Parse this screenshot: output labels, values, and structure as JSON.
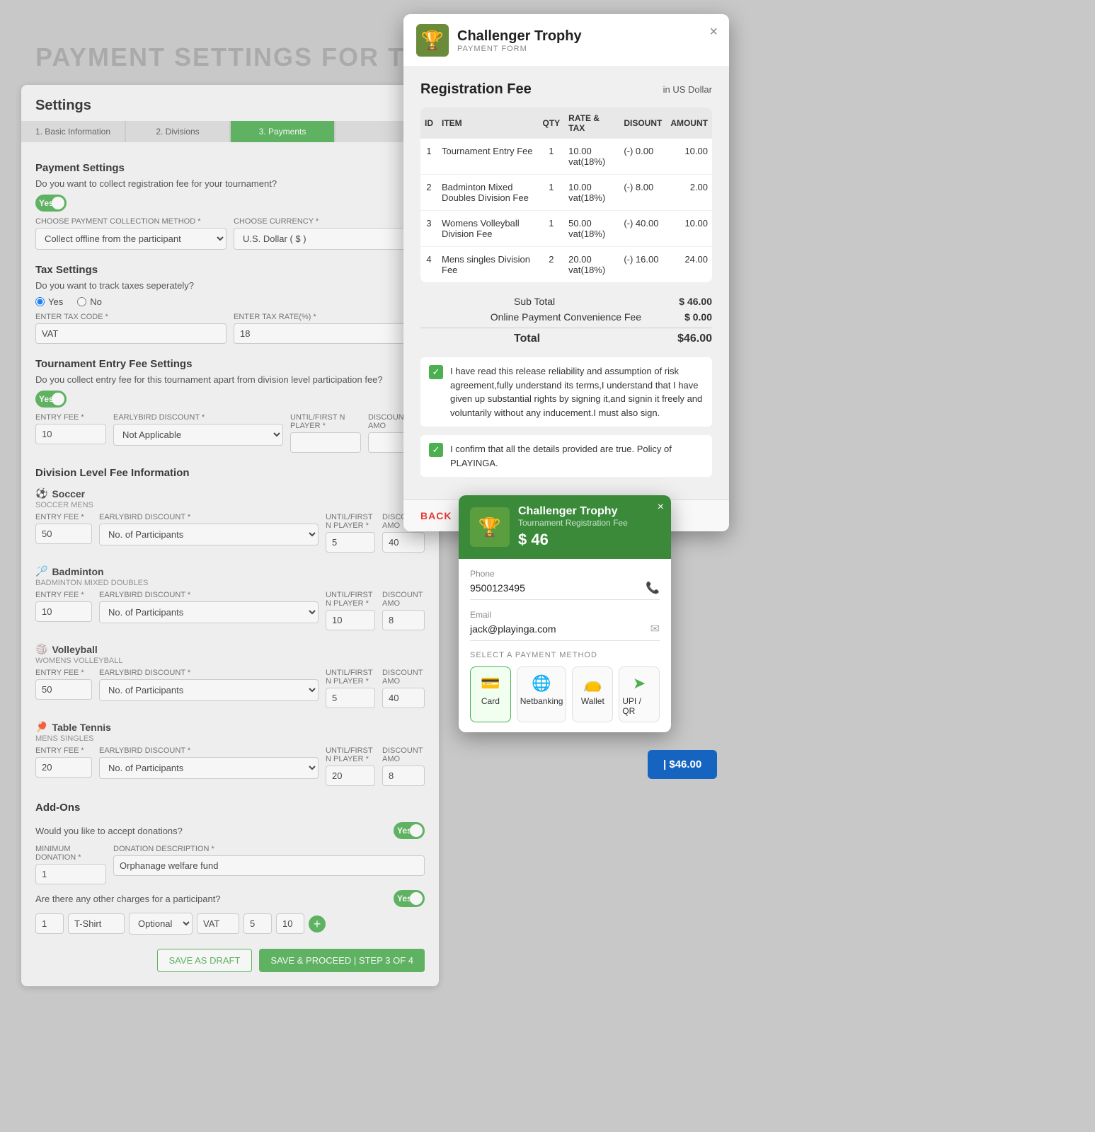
{
  "bg_text": "PAYMENT SETTINGS FOR TOURNAMENT",
  "settings": {
    "title": "Settings",
    "steps": [
      {
        "label": "1. Basic Information",
        "active": false
      },
      {
        "label": "2. Divisions",
        "active": false
      },
      {
        "label": "3. Payments",
        "active": true
      },
      {
        "label": "",
        "active": false
      }
    ],
    "payment_settings": {
      "title": "Payment Settings",
      "desc": "Do you want to collect registration fee for your tournament?",
      "toggle_label": "Yes",
      "collection_method_label": "CHOOSE PAYMENT COLLECTION METHOD *",
      "collection_method_value": "Collect offline from the participant",
      "currency_label": "CHOOSE CURRENCY *",
      "currency_value": "U.S. Dollar ( $ )"
    },
    "tax_settings": {
      "title": "Tax Settings",
      "desc": "Do you want to track taxes seperately?",
      "radio_yes": "Yes",
      "radio_no": "No",
      "tax_code_label": "ENTER TAX CODE *",
      "tax_code_value": "VAT",
      "tax_rate_label": "ENTER TAX RATE(%) *",
      "tax_rate_value": "18"
    },
    "entry_fee": {
      "title": "Tournament Entry Fee Settings",
      "desc": "Do you collect entry fee for this tournament apart from division level participation fee?",
      "toggle_label": "Yes",
      "entry_fee_label": "ENTRY FEE *",
      "entry_fee_value": "10",
      "earlybird_label": "EARLYBIRD DISCOUNT *",
      "earlybird_value": "Not Applicable",
      "until_label": "UNTIL/FIRST N PLAYER *",
      "until_value": "",
      "discount_label": "DISCOUNT AMO"
    },
    "division_fee": {
      "title": "Division Level Fee Information",
      "sports": [
        {
          "icon": "⚽",
          "name": "Soccer",
          "subtitle": "SOCCER MENS",
          "entry_fee": "50",
          "earlybird": "No. of Participants",
          "until": "5",
          "discount": "40"
        },
        {
          "icon": "🏸",
          "name": "Badminton",
          "subtitle": "BADMINTON MIXED DOUBLES",
          "entry_fee": "10",
          "earlybird": "No. of Participants",
          "until": "10",
          "discount": "8"
        },
        {
          "icon": "🏐",
          "name": "Volleyball",
          "subtitle": "WOMENS VOLLEYBALL",
          "entry_fee": "50",
          "earlybird": "No. of Participants",
          "until": "5",
          "discount": "40"
        },
        {
          "icon": "🏓",
          "name": "Table Tennis",
          "subtitle": "MENS SINGLES",
          "entry_fee": "20",
          "earlybird": "No. of Participants",
          "until": "20",
          "discount": "8"
        }
      ]
    },
    "add_ons": {
      "title": "Add-Ons",
      "donations_desc": "Would you like to accept donations?",
      "toggle_label": "Yes",
      "min_donation_label": "MINIMUM DONATION *",
      "min_donation_value": "1",
      "donation_desc_label": "DONATION DESCRIPTION *",
      "donation_desc_value": "Orphanage welfare fund",
      "other_charges_desc": "Are there any other charges for a participant?",
      "other_toggle_label": "Yes",
      "charge_qty": "1",
      "charge_name": "T-Shirt",
      "charge_type": "Optional",
      "charge_tax": "VAT",
      "charge_price": "5",
      "charge_discount": "10"
    },
    "buttons": {
      "save_draft": "SAVE AS DRAFT",
      "proceed": "SAVE & PROCEED | STEP 3 OF 4"
    }
  },
  "payment_form": {
    "title": "Challenger Trophy",
    "subtitle": "PAYMENT FORM",
    "close_label": "×",
    "logo_emoji": "🏆",
    "registration_fee_title": "Registration Fee",
    "currency_label": "in US Dollar",
    "table": {
      "headers": [
        "ID",
        "ITEM",
        "QTY",
        "RATE & TAX",
        "DISOUNT",
        "AMOUNT"
      ],
      "rows": [
        {
          "id": "1",
          "item": "Tournament Entry Fee",
          "qty": "1",
          "rate": "10.00 vat(18%)",
          "discount": "(-) 0.00",
          "amount": "10.00"
        },
        {
          "id": "2",
          "item": "Badminton Mixed Doubles Division Fee",
          "qty": "1",
          "rate": "10.00 vat(18%)",
          "discount": "(-) 8.00",
          "amount": "2.00"
        },
        {
          "id": "3",
          "item": "Womens Volleyball Division Fee",
          "qty": "1",
          "rate": "50.00 vat(18%)",
          "discount": "(-) 40.00",
          "amount": "10.00"
        },
        {
          "id": "4",
          "item": "Mens singles Division Fee",
          "qty": "2",
          "rate": "20.00 vat(18%)",
          "discount": "(-) 16.00",
          "amount": "24.00"
        }
      ]
    },
    "sub_total_label": "Sub Total",
    "sub_total_amount": "$ 46.00",
    "convenience_fee_label": "Online Payment Convenience Fee",
    "convenience_fee_amount": "$ 0.00",
    "total_label": "Total",
    "total_amount": "$46.00",
    "agreement_text": "I have read this release reliability and assumption of risk agreement,fully understand its terms,I understand that I have given up substantial rights by signing it,and signin it freely and voluntarily without any inducement.I must also sign.",
    "agreement_text2": "I confirm that all the details provided are true. Policy of PLAYINGA.",
    "back_label": "BACK"
  },
  "payment_widget": {
    "title": "Challenger Trophy",
    "subtitle": "Tournament Registration Fee",
    "amount": "$ 46",
    "logo_emoji": "🏆",
    "close_label": "×",
    "phone_label": "Phone",
    "phone_value": "9500123495",
    "email_label": "Email",
    "email_value": "jack@playinga.com",
    "select_method_label": "SELECT A PAYMENT METHOD",
    "methods": [
      {
        "id": "card",
        "label": "Card",
        "icon": "💳"
      },
      {
        "id": "netbanking",
        "label": "Netbanking",
        "icon": "🌐"
      },
      {
        "id": "wallet",
        "label": "Wallet",
        "icon": "👝"
      },
      {
        "id": "upi",
        "label": "UPI / QR",
        "icon": "➤"
      }
    ],
    "pay_button": "| $46.00"
  }
}
